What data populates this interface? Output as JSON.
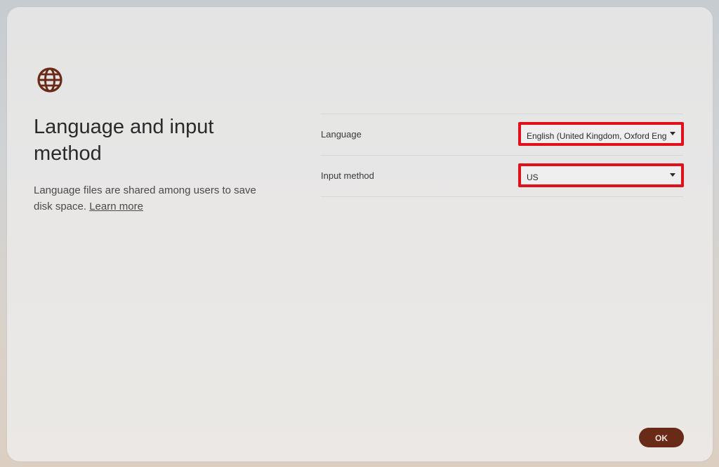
{
  "dialog": {
    "title": "Language and input method",
    "description": "Language files are shared among users to save disk space. ",
    "learn_more_link": "Learn more",
    "icon": "globe-icon"
  },
  "settings": {
    "language": {
      "label": "Language",
      "selected": "English (United Kingdom, Oxford English)"
    },
    "input_method": {
      "label": "Input method",
      "selected": "US"
    }
  },
  "actions": {
    "ok_label": "OK"
  },
  "colors": {
    "accent": "#6a2a18",
    "highlight_border": "#e0111b"
  }
}
